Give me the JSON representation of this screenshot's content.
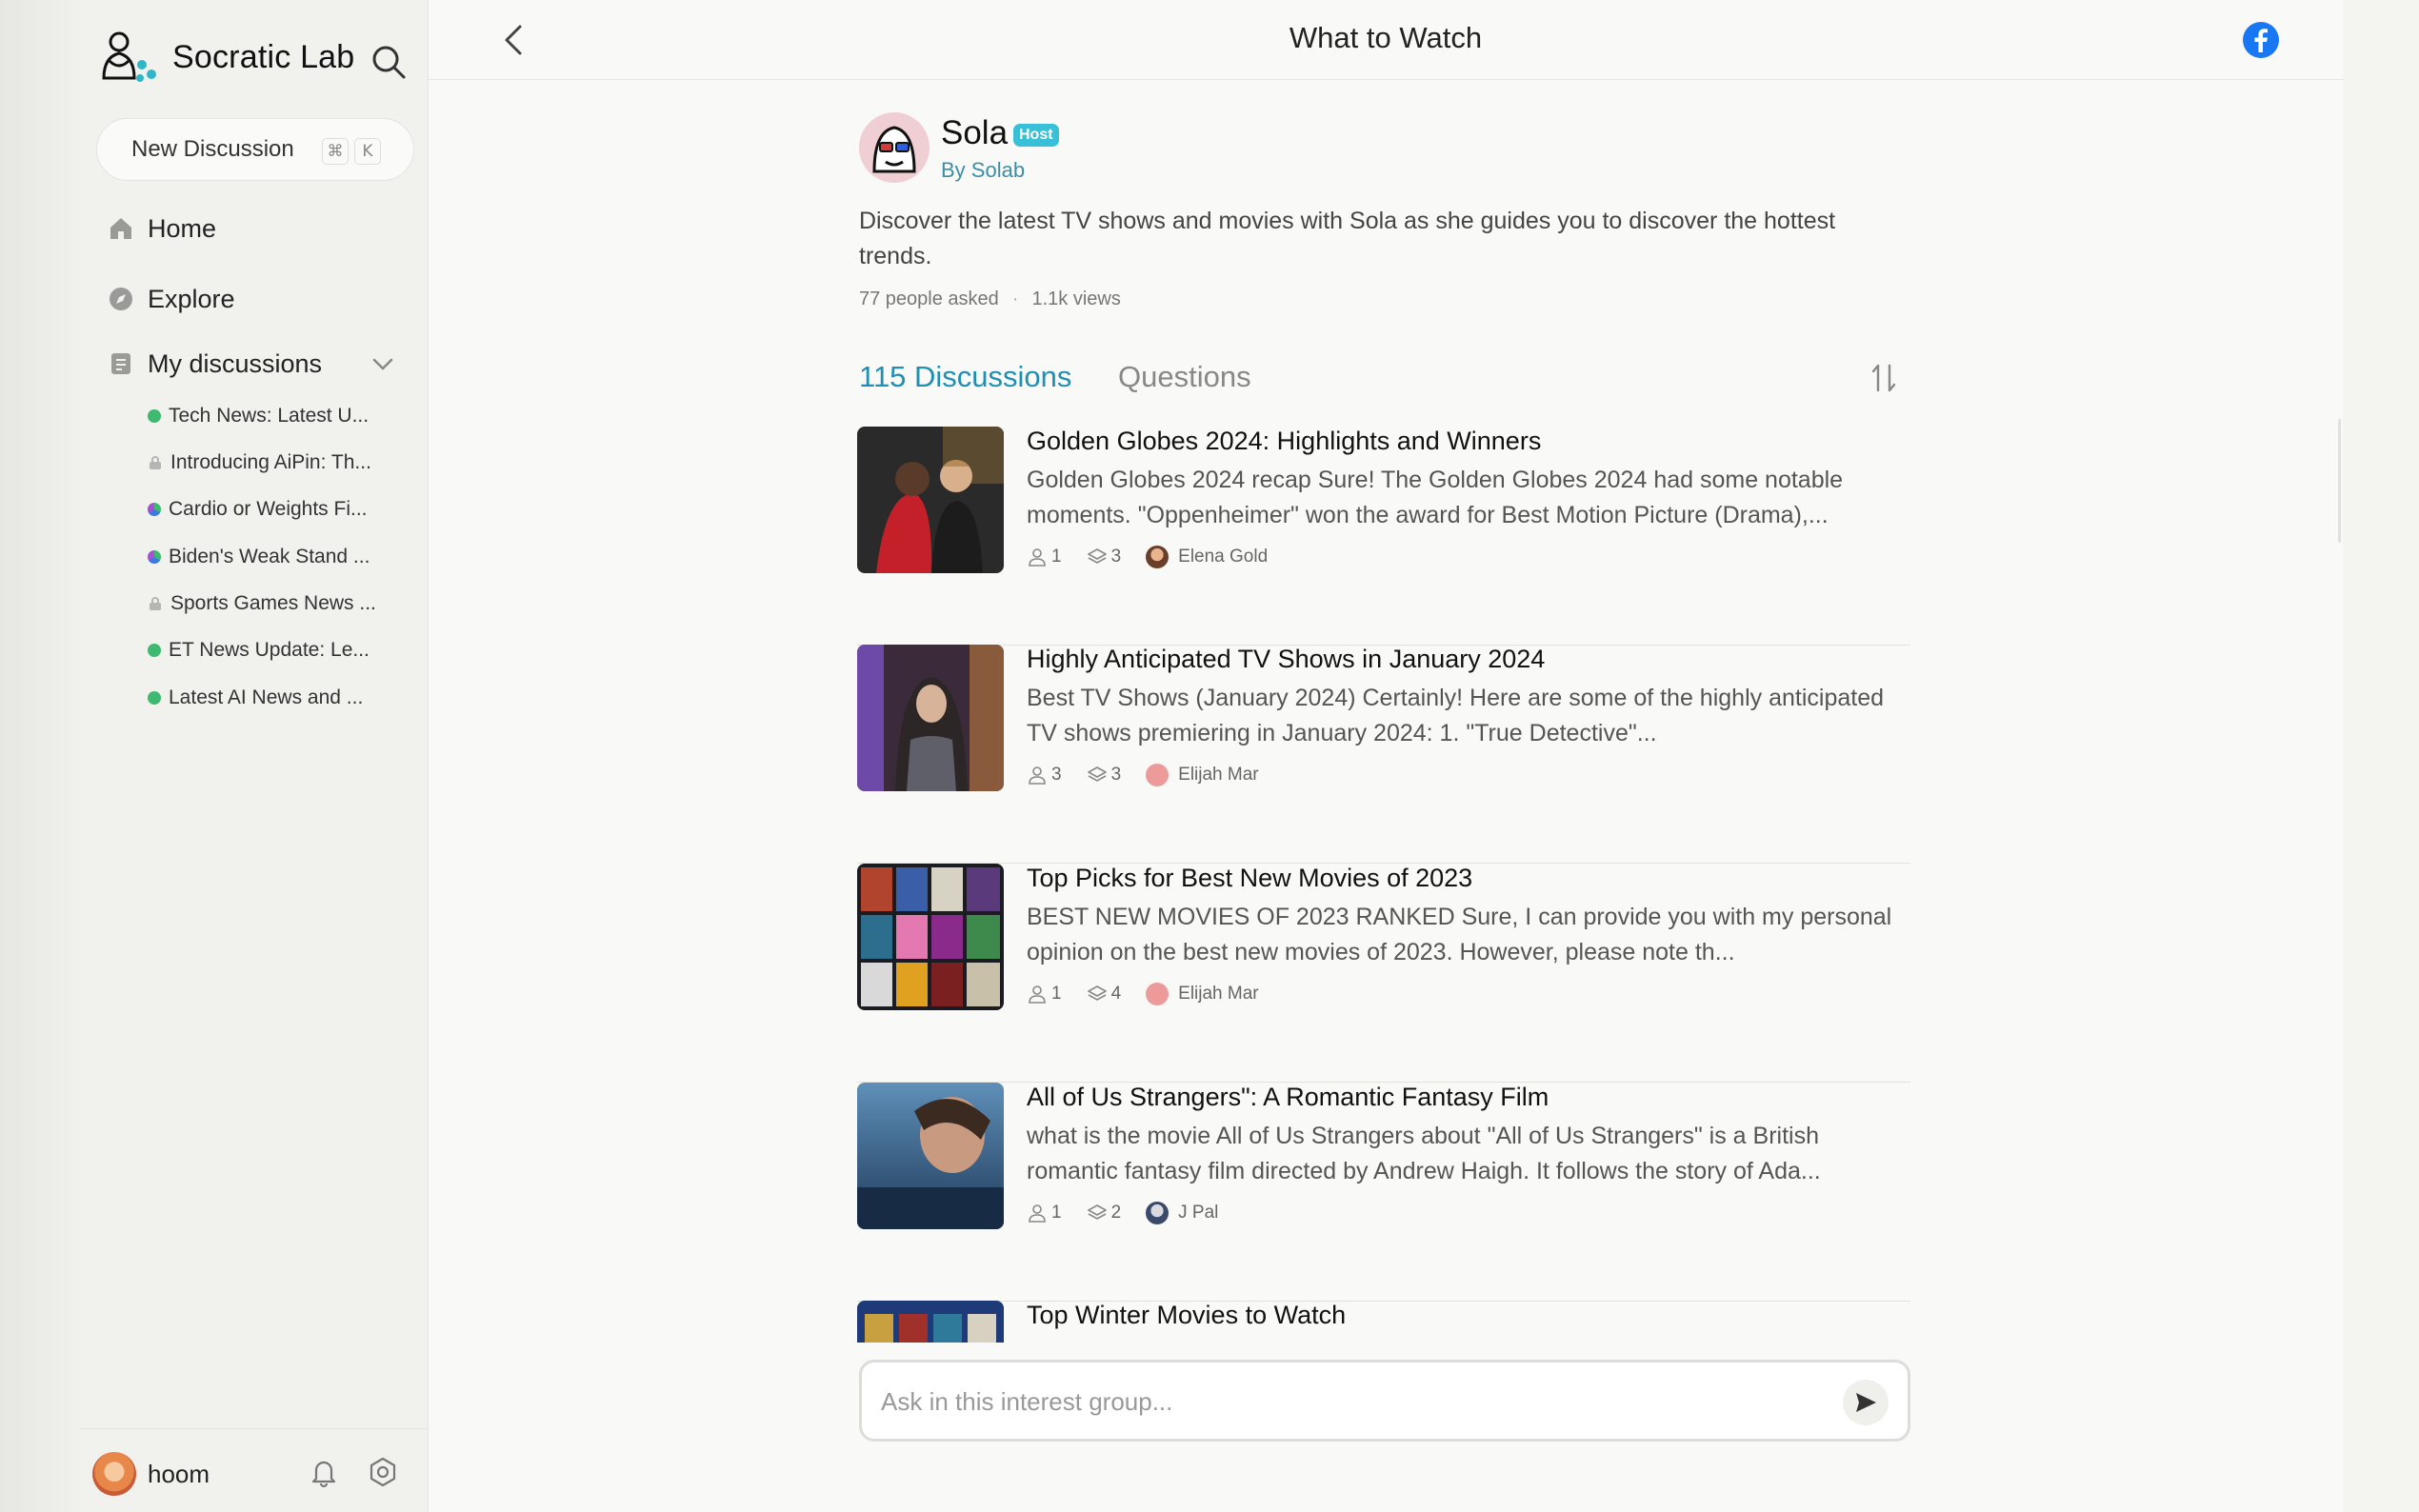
{
  "app": {
    "brand_name": "Socratic Lab"
  },
  "sidebar": {
    "new_discussion_label": "New Discussion",
    "shortcut_keys": [
      "⌘",
      "K"
    ],
    "nav": [
      {
        "label": "Home",
        "icon": "home-icon"
      },
      {
        "label": "Explore",
        "icon": "compass-icon"
      },
      {
        "label": "My discussions",
        "icon": "document-icon"
      }
    ],
    "discussions": [
      {
        "label": "Tech News: Latest U...",
        "status": "green-dot"
      },
      {
        "label": "Introducing AiPin: Th...",
        "status": "lock-icon"
      },
      {
        "label": "Cardio or Weights Fi...",
        "status": "multi-dot"
      },
      {
        "label": "Biden's Weak Stand ...",
        "status": "multi-dot"
      },
      {
        "label": "Sports Games News ...",
        "status": "lock-icon"
      },
      {
        "label": "ET News Update: Le...",
        "status": "green-dot"
      },
      {
        "label": "Latest AI News and ...",
        "status": "green-dot"
      }
    ],
    "user": {
      "name": "hoom"
    }
  },
  "header": {
    "title": "What to Watch"
  },
  "group": {
    "host_name": "Sola",
    "host_badge": "Host",
    "host_by": "By Solab",
    "description": "Discover the latest TV shows and movies with Sola as she guides you to discover the hottest trends.",
    "people_asked": "77 people asked",
    "separator": "·",
    "views": "1.1k views"
  },
  "tabs": {
    "discussions": "115 Discussions",
    "questions": "Questions"
  },
  "cards": [
    {
      "title": "Golden Globes 2024: Highlights and Winners",
      "excerpt": "Golden Globes 2024 recap Sure! The Golden Globes 2024 had some notable moments. \"Oppenheimer\" won the award for Best Motion Picture (Drama),...",
      "people": "1",
      "layers": "3",
      "author": "Elena Gold"
    },
    {
      "title": "Highly Anticipated TV Shows in January 2024",
      "excerpt": "Best TV Shows (January 2024) Certainly! Here are some of the highly anticipated TV shows premiering in January 2024: 1. \"True Detective\"...",
      "people": "3",
      "layers": "3",
      "author": "Elijah Mar"
    },
    {
      "title": "Top Picks for Best New Movies of 2023",
      "excerpt": "BEST NEW MOVIES OF 2023 RANKED Sure, I can provide you with my personal opinion on the best new movies of 2023. However, please note th...",
      "people": "1",
      "layers": "4",
      "author": "Elijah Mar"
    },
    {
      "title": "All of Us Strangers\": A Romantic Fantasy Film",
      "excerpt": "what is the movie All of Us Strangers about \"All of Us Strangers\" is a British romantic fantasy film directed by Andrew Haigh. It follows the story of Ada...",
      "people": "1",
      "layers": "2",
      "author": "J Pal"
    },
    {
      "title": "Top Winter Movies to Watch"
    }
  ],
  "ask": {
    "placeholder": "Ask in this interest group..."
  },
  "colors": {
    "accent": "#1f8fb3",
    "badge": "#37c0d8",
    "facebook": "#1877f2"
  }
}
